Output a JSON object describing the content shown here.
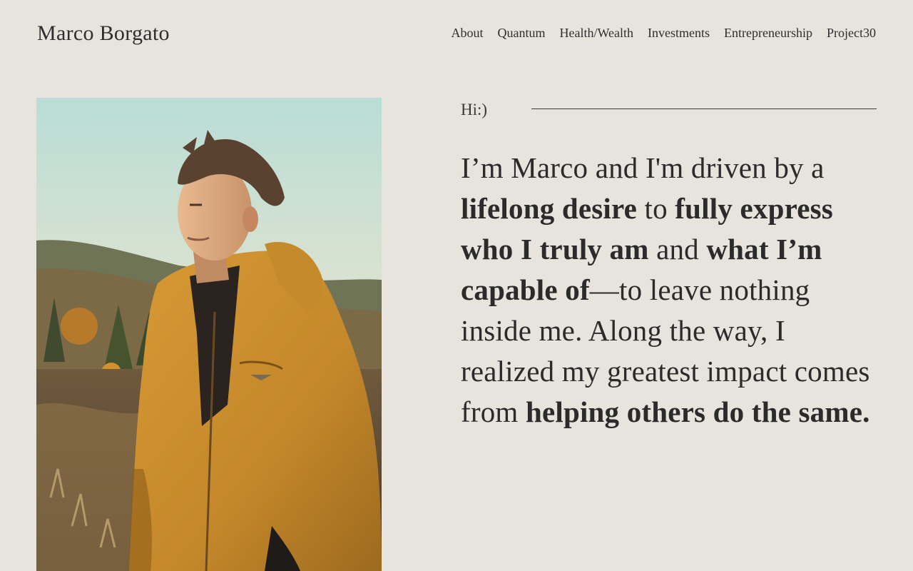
{
  "header": {
    "brand": "Marco Borgato",
    "nav": [
      {
        "label": "About"
      },
      {
        "label": "Quantum"
      },
      {
        "label": "Health/Wealth"
      },
      {
        "label": "Investments"
      },
      {
        "label": "Entrepreneurship"
      },
      {
        "label": "Project30"
      }
    ]
  },
  "hero": {
    "greeting": "Hi:)",
    "statement": [
      {
        "text": "I’m Marco and I'm driven by a ",
        "bold": false
      },
      {
        "text": "lifelong desire",
        "bold": true
      },
      {
        "text": " to ",
        "bold": false
      },
      {
        "text": "fully express who I truly am",
        "bold": true
      },
      {
        "text": " and ",
        "bold": false
      },
      {
        "text": "what I’m capable of",
        "bold": true
      },
      {
        "text": "—to leave nothing inside me. Along the way, I realized my greatest impact comes from ",
        "bold": false
      },
      {
        "text": "helping others do the same.",
        "bold": true
      }
    ]
  },
  "colors": {
    "background": "#e7e3dd",
    "text": "#2b2b2b",
    "jacket": "#c98f2b"
  }
}
